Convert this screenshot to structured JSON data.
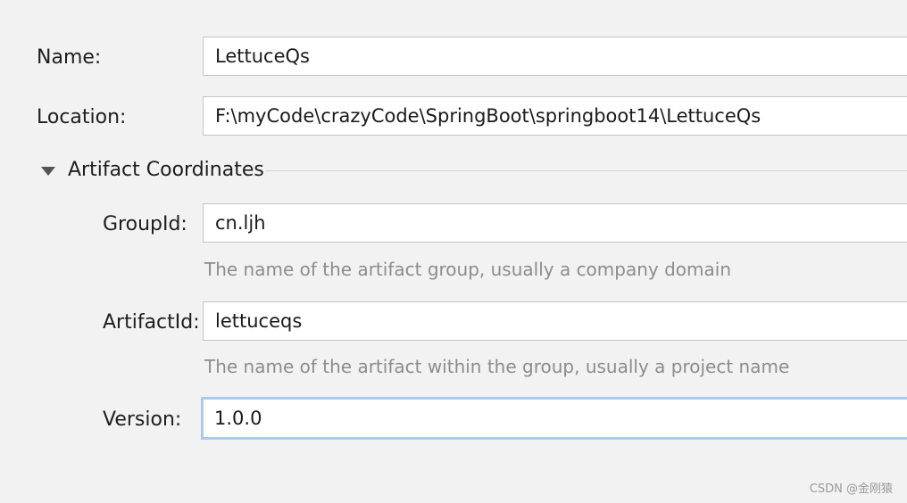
{
  "form": {
    "name": {
      "label": "Name:",
      "value": "LettuceQs"
    },
    "location": {
      "label": "Location:",
      "value": "F:\\myCode\\crazyCode\\SpringBoot\\springboot14\\LettuceQs"
    },
    "artifact_section": {
      "title": "Artifact Coordinates",
      "expanded": true
    },
    "group_id": {
      "label": "GroupId:",
      "value": "cn.ljh",
      "hint": "The name of the artifact group, usually a company domain"
    },
    "artifact_id": {
      "label": "ArtifactId:",
      "value": "lettuceqs",
      "hint": "The name of the artifact within the group, usually a project name"
    },
    "version": {
      "label": "Version:",
      "value": "1.0.0",
      "focused": true
    }
  },
  "watermark": "CSDN @金刚猿",
  "colors": {
    "background": "#f2f2f2",
    "focus_border": "#aacbef",
    "hint_text": "#8c8c8c"
  },
  "icons": {
    "section_toggle": "triangle-down-icon"
  }
}
